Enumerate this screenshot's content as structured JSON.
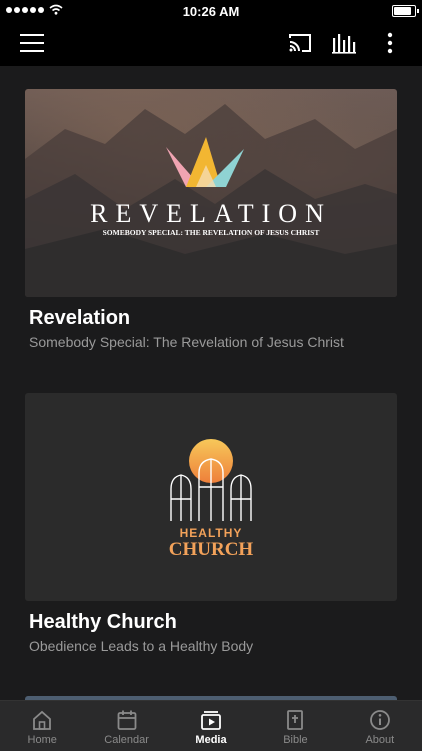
{
  "status_bar": {
    "time": "10:26 AM",
    "battery_level": 0.95
  },
  "top_bar": {
    "menu_icon": "hamburger-menu-icon",
    "cast_icon": "cast-icon",
    "bars_icon": "audio-bars-icon",
    "more_icon": "more-vertical-icon"
  },
  "media": [
    {
      "title": "Revelation",
      "subtitle": "Somebody Special: The Revelation of Jesus Christ",
      "artwork": {
        "word": "REVELATION",
        "tagline": "SOMEBODY SPECIAL: THE REVELATION OF JESUS CHRIST"
      }
    },
    {
      "title": "Healthy Church",
      "subtitle": "Obedience Leads to a Healthy Body",
      "artwork": {
        "line1": "HEALTHY",
        "line2": "CHURCH"
      }
    }
  ],
  "tab_bar": {
    "tabs": [
      {
        "label": "Home",
        "icon": "home-icon"
      },
      {
        "label": "Calendar",
        "icon": "calendar-icon"
      },
      {
        "label": "Media",
        "icon": "media-icon",
        "active": true
      },
      {
        "label": "Bible",
        "icon": "bible-icon"
      },
      {
        "label": "About",
        "icon": "info-icon"
      }
    ]
  },
  "colors": {
    "background": "#1b1b1c",
    "bar": "#000000",
    "tab_bar": "#2a2a2b",
    "subtitle": "#9a9a9a",
    "accent": "#f3a25a"
  }
}
